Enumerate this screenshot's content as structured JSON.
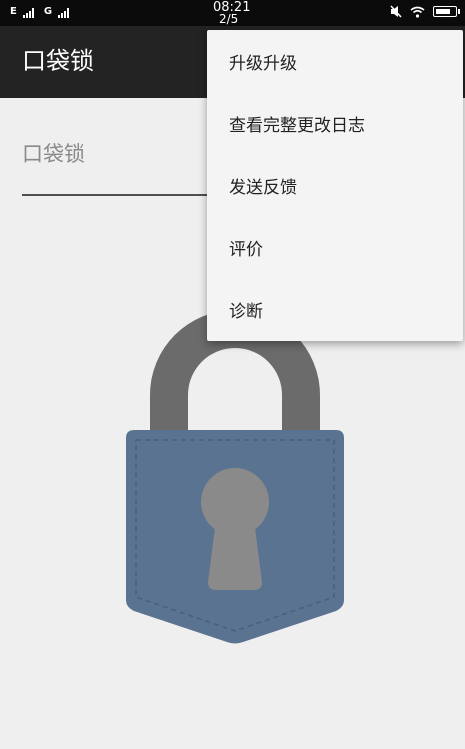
{
  "status_bar": {
    "sim1_label": "E",
    "sim2_label": "G",
    "time": "08:21",
    "page_indicator": "2/5",
    "battery_level": 0.85
  },
  "app_bar": {
    "title": "口袋锁"
  },
  "name_field": {
    "placeholder": "口袋锁",
    "value": ""
  },
  "overflow_menu": {
    "items": [
      {
        "label": "升级升级"
      },
      {
        "label": "查看完整更改日志"
      },
      {
        "label": "发送反馈"
      },
      {
        "label": "评价"
      },
      {
        "label": "诊断"
      }
    ]
  },
  "colors": {
    "status_bar": "#0b0b0b",
    "app_bar": "#232323",
    "background": "#efefef",
    "menu_background": "#f4f4f4",
    "shackle": "#6b6b6b",
    "lock_body": "#5a7391",
    "keyhole": "#8a8a8a"
  },
  "icons": {
    "mute": "mute-icon",
    "wifi": "wifi-icon",
    "battery": "battery-icon",
    "signal": "signal-bars-icon",
    "lock": "padlock-icon"
  }
}
